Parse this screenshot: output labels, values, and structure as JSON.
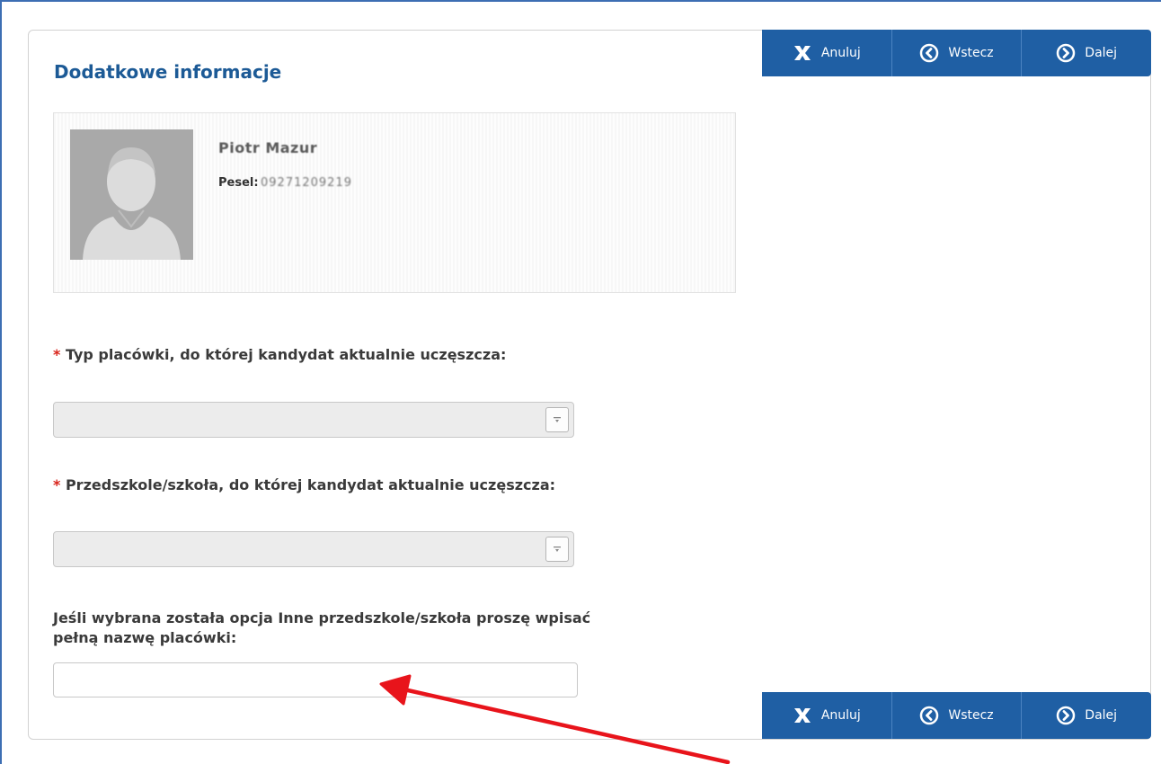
{
  "page": {
    "title": "Dodatkowe informacje"
  },
  "toolbar": {
    "cancel_label": "Anuluj",
    "back_label": "Wstecz",
    "next_label": "Dalej"
  },
  "candidate": {
    "name": "Piotr Mazur",
    "pesel_label": "Pesel:",
    "pesel_value": "09271209219"
  },
  "form": {
    "required_marker": "*",
    "school_type_label": "Typ placówki, do której kandydat aktualnie uczęszcza:",
    "school_type_value": "",
    "school_label": "Przedszkole/szkoła, do której kandydat aktualnie uczęszcza:",
    "school_value": "",
    "other_school_label": "Jeśli wybrana została opcja Inne przedszkole/szkoła proszę wpisać pełną nazwę placówki:",
    "other_school_value": ""
  },
  "colors": {
    "toolbar_bg": "#1f5fa4",
    "title": "#1c5a96",
    "required": "#d9241b",
    "annotation_arrow": "#e8141b"
  },
  "icons": {
    "cancel": "x-icon",
    "back": "circle-chevron-left-icon",
    "next": "circle-chevron-right-icon",
    "select_arrow": "dropdown-arrow-icon"
  }
}
